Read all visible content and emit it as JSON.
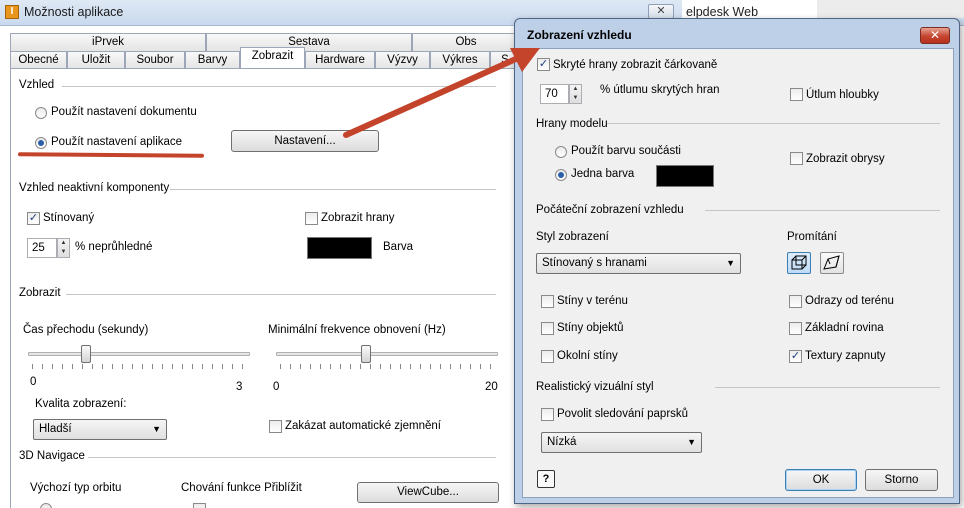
{
  "background_window": {
    "title": "Možnosti aplikace",
    "app_icon_letter": "I",
    "close_glyph": "✕",
    "behind_text": "elpdesk Web",
    "tabs_top": [
      "iPrvek",
      "Sestava",
      "Obs"
    ],
    "tabs_bottom": [
      "Obecné",
      "Uložit",
      "Soubor",
      "Barvy",
      "Zobrazit",
      "Hardware",
      "Výzvy",
      "Výkres",
      "S"
    ],
    "active_tab": "Zobrazit",
    "vzhled": {
      "heading": "Vzhled",
      "opt_document": "Použít nastavení dokumentu",
      "opt_app": "Použít nastavení aplikace",
      "settings_button": "Nastavení..."
    },
    "inactive": {
      "heading": "Vzhled neaktivní komponenty",
      "shaded": "Stínovaný",
      "show_edges": "Zobrazit hrany",
      "opacity_value": "25",
      "opacity_label": "% neprůhledné",
      "color_label": "Barva"
    },
    "display": {
      "heading": "Zobrazit",
      "transition_label": "Čas přechodu (sekundy)",
      "transition_min": "0",
      "transition_max": "3",
      "transition_value_fraction": 0.25,
      "refresh_label": "Minimální frekvence obnovení (Hz)",
      "refresh_min": "0",
      "refresh_max": "20",
      "refresh_value_fraction": 0.4,
      "quality_label": "Kvalita zobrazení:",
      "quality_value": "Hladší",
      "disable_auto_zoom": "Zakázat automatické zjemnění"
    },
    "nav3d": {
      "heading": "3D Navigace",
      "orbit_label": "Výchozí typ orbitu",
      "zoom_behavior_label": "Chování funkce Přiblížit",
      "viewcube_button": "ViewCube..."
    }
  },
  "dialog": {
    "title": "Zobrazení vzhledu",
    "close_glyph": "✕",
    "hidden_edges_dashed": "Skryté hrany zobrazit čárkovaně",
    "dim_value": "70",
    "dim_label": "% útlumu skrytých hran",
    "depth_dim": "Útlum hloubky",
    "model_edges": {
      "heading": "Hrany modelu",
      "use_part_color": "Použít barvu součásti",
      "single_color": "Jedna barva",
      "show_silhouettes": "Zobrazit obrysy"
    },
    "initial": {
      "heading": "Počáteční zobrazení vzhledu",
      "style_label": "Styl zobrazení",
      "style_value": "Stínovaný s hranami",
      "projection_label": "Promítání"
    },
    "options": {
      "ground_shadows": "Stíny v terénu",
      "object_shadows": "Stíny objektů",
      "ambient_shadows": "Okolní stíny",
      "ground_reflections": "Odrazy od terénu",
      "ground_plane": "Základní rovina",
      "textures_on": "Textury zapnuty"
    },
    "realistic": {
      "heading": "Realistický vizuální styl",
      "ray_tracing": "Povolit sledování paprsků",
      "quality_value": "Nízká"
    },
    "help_glyph": "?",
    "ok": "OK",
    "cancel": "Storno",
    "check_glyph": "✓"
  },
  "colors": {
    "annotation_red": "#c4432b",
    "dialog_frame": "#bdd0e8",
    "swatch": "#000000"
  }
}
